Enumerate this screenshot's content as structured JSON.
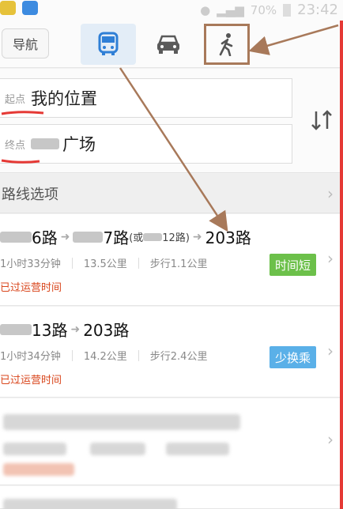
{
  "status_bar": {
    "battery": "70%",
    "time": "23:42"
  },
  "header": {
    "back_label": "导航",
    "modes": [
      {
        "name": "bus",
        "icon": "bus-icon",
        "selected": true
      },
      {
        "name": "car",
        "icon": "car-icon",
        "selected": false
      },
      {
        "name": "walk",
        "icon": "walk-icon",
        "selected": false
      }
    ]
  },
  "inputs": {
    "start_label": "起点",
    "start_value": "我的位置",
    "end_label": "终点",
    "end_value": "广场",
    "swap_icon": "swap-icon"
  },
  "options": {
    "label": "路线选项"
  },
  "routes": [
    {
      "title_1": "6路",
      "title_2": "7路",
      "title_alt_prefix": "(或",
      "title_alt_suffix": "12路)",
      "title_3": "203路",
      "duration": "1小时33分钟",
      "distance": "13.5公里",
      "walk": "步行1.1公里",
      "status": "已过运营时间",
      "badge": "时间短",
      "badge_color": "#6cc04a"
    },
    {
      "title_1": "13路",
      "title_2": "203路",
      "duration": "1小时34分钟",
      "distance": "14.2公里",
      "walk": "步行2.4公里",
      "status": "已过运营时间",
      "badge": "少换乘",
      "badge_color": "#5ab0e8"
    }
  ],
  "colors": {
    "annotation": "#a8795a",
    "status_red": "#d9461c",
    "selected_mode": "#2f7fd6"
  }
}
